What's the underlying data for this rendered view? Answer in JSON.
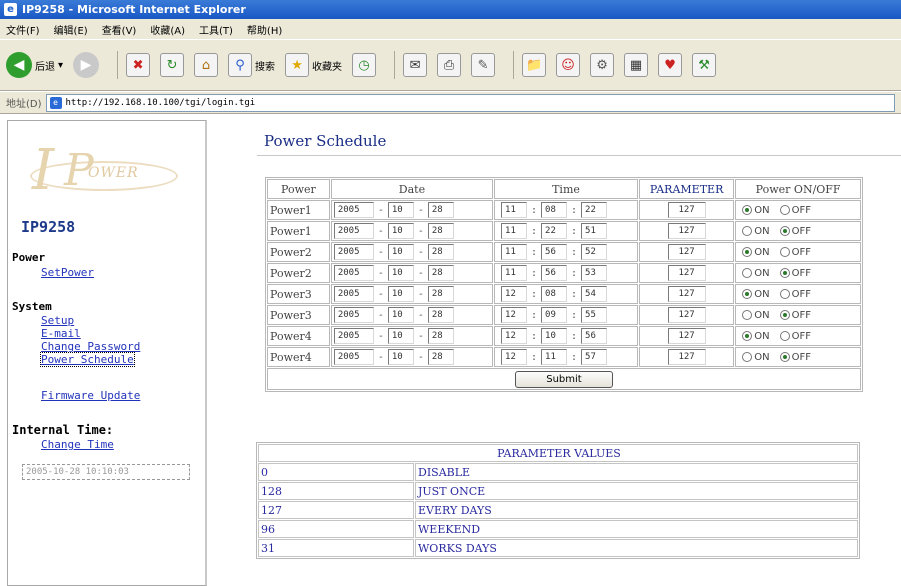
{
  "window": {
    "title": "IP9258 - Microsoft Internet Explorer"
  },
  "menu": [
    "文件(F)",
    "编辑(E)",
    "查看(V)",
    "收藏(A)",
    "工具(T)",
    "帮助(H)"
  ],
  "toolbar": {
    "back_label": "后退",
    "search_label": "搜索",
    "favorites_label": "收藏夹"
  },
  "address": {
    "label": "地址(D)",
    "url": "http://192.168.10.100/tgi/login.tgi"
  },
  "sidebar": {
    "logo_text": "IPower",
    "device_name": "IP9258",
    "power_heading": "Power",
    "set_power": "SetPower",
    "system_heading": "System",
    "setup": "Setup",
    "email": "E-mail",
    "change_password": "Change Password",
    "power_schedule": "Power Schedule",
    "firmware_update": "Firmware Update",
    "internal_time_heading": "Internal Time:",
    "change_time": "Change Time",
    "clock_value": "2005-10-28 10:10:03"
  },
  "main": {
    "title": "Power Schedule",
    "headers": {
      "power": "Power",
      "date": "Date",
      "time": "Time",
      "parameter": "PARAMETER",
      "onoff": "Power ON/OFF"
    },
    "on_label": "ON",
    "off_label": "OFF",
    "submit_label": "Submit",
    "rows": [
      {
        "power": "Power1",
        "year": "2005",
        "month": "10",
        "day": "28",
        "hour": "11",
        "minute": "08",
        "second": "22",
        "param": "127",
        "state": "on"
      },
      {
        "power": "Power1",
        "year": "2005",
        "month": "10",
        "day": "28",
        "hour": "11",
        "minute": "22",
        "second": "51",
        "param": "127",
        "state": "off"
      },
      {
        "power": "Power2",
        "year": "2005",
        "month": "10",
        "day": "28",
        "hour": "11",
        "minute": "56",
        "second": "52",
        "param": "127",
        "state": "on"
      },
      {
        "power": "Power2",
        "year": "2005",
        "month": "10",
        "day": "28",
        "hour": "11",
        "minute": "56",
        "second": "53",
        "param": "127",
        "state": "off"
      },
      {
        "power": "Power3",
        "year": "2005",
        "month": "10",
        "day": "28",
        "hour": "12",
        "minute": "08",
        "second": "54",
        "param": "127",
        "state": "on"
      },
      {
        "power": "Power3",
        "year": "2005",
        "month": "10",
        "day": "28",
        "hour": "12",
        "minute": "09",
        "second": "55",
        "param": "127",
        "state": "off"
      },
      {
        "power": "Power4",
        "year": "2005",
        "month": "10",
        "day": "28",
        "hour": "12",
        "minute": "10",
        "second": "56",
        "param": "127",
        "state": "on"
      },
      {
        "power": "Power4",
        "year": "2005",
        "month": "10",
        "day": "28",
        "hour": "12",
        "minute": "11",
        "second": "57",
        "param": "127",
        "state": "off"
      }
    ],
    "param_table": {
      "heading": "PARAMETER VALUES",
      "rows": [
        {
          "code": "0",
          "meaning": "DISABLE"
        },
        {
          "code": "128",
          "meaning": "JUST ONCE"
        },
        {
          "code": "127",
          "meaning": "EVERY DAYS"
        },
        {
          "code": "96",
          "meaning": "WEEKEND"
        },
        {
          "code": "31",
          "meaning": "WORKS DAYS"
        }
      ]
    }
  }
}
